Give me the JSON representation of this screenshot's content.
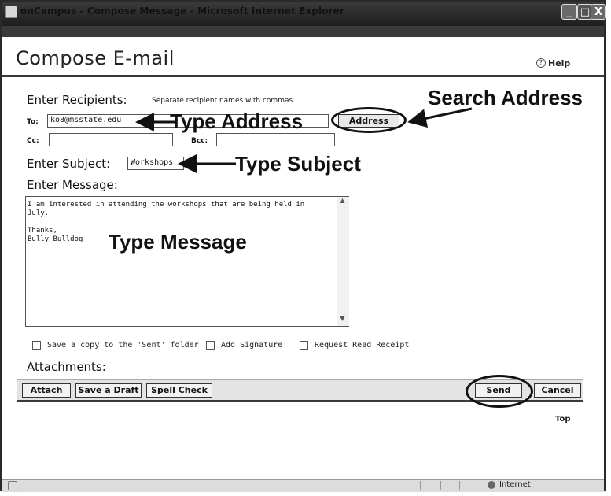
{
  "window": {
    "title": "onCampus - Compose Message - Microsoft Internet Explorer",
    "minimize_label": "_",
    "maximize_label": "□",
    "close_label": "X"
  },
  "header": {
    "title": "Compose E-mail",
    "help_icon": "?",
    "help_label": "Help"
  },
  "recipients": {
    "heading": "Enter Recipients:",
    "hint": "Separate recipient names with commas.",
    "to_label": "To:",
    "to_value": "ko8@msstate.edu",
    "cc_label": "Cc:",
    "cc_value": "",
    "bcc_label": "Bcc:",
    "bcc_value": "",
    "address_button": "Address"
  },
  "subject": {
    "heading": "Enter Subject:",
    "value": "Workshops"
  },
  "message": {
    "heading": "Enter Message:",
    "body": "I am interested in attending the workshops that are being held in\nJuly.\n\nThanks,\nBully Bulldog"
  },
  "options": {
    "save_copy": "Save a copy to the 'Sent' folder",
    "add_signature": "Add Signature",
    "read_receipt": "Request Read Receipt"
  },
  "attachments": {
    "heading": "Attachments:"
  },
  "actions": {
    "attach": "Attach",
    "save_draft": "Save a Draft",
    "spell_check": "Spell Check",
    "send": "Send",
    "cancel": "Cancel"
  },
  "footer": {
    "top_link": "Top"
  },
  "status": {
    "zone": "Internet"
  },
  "annotations": {
    "search_address": "Search Address",
    "type_address": "Type Address",
    "type_subject": "Type Subject",
    "type_message": "Type Message"
  }
}
